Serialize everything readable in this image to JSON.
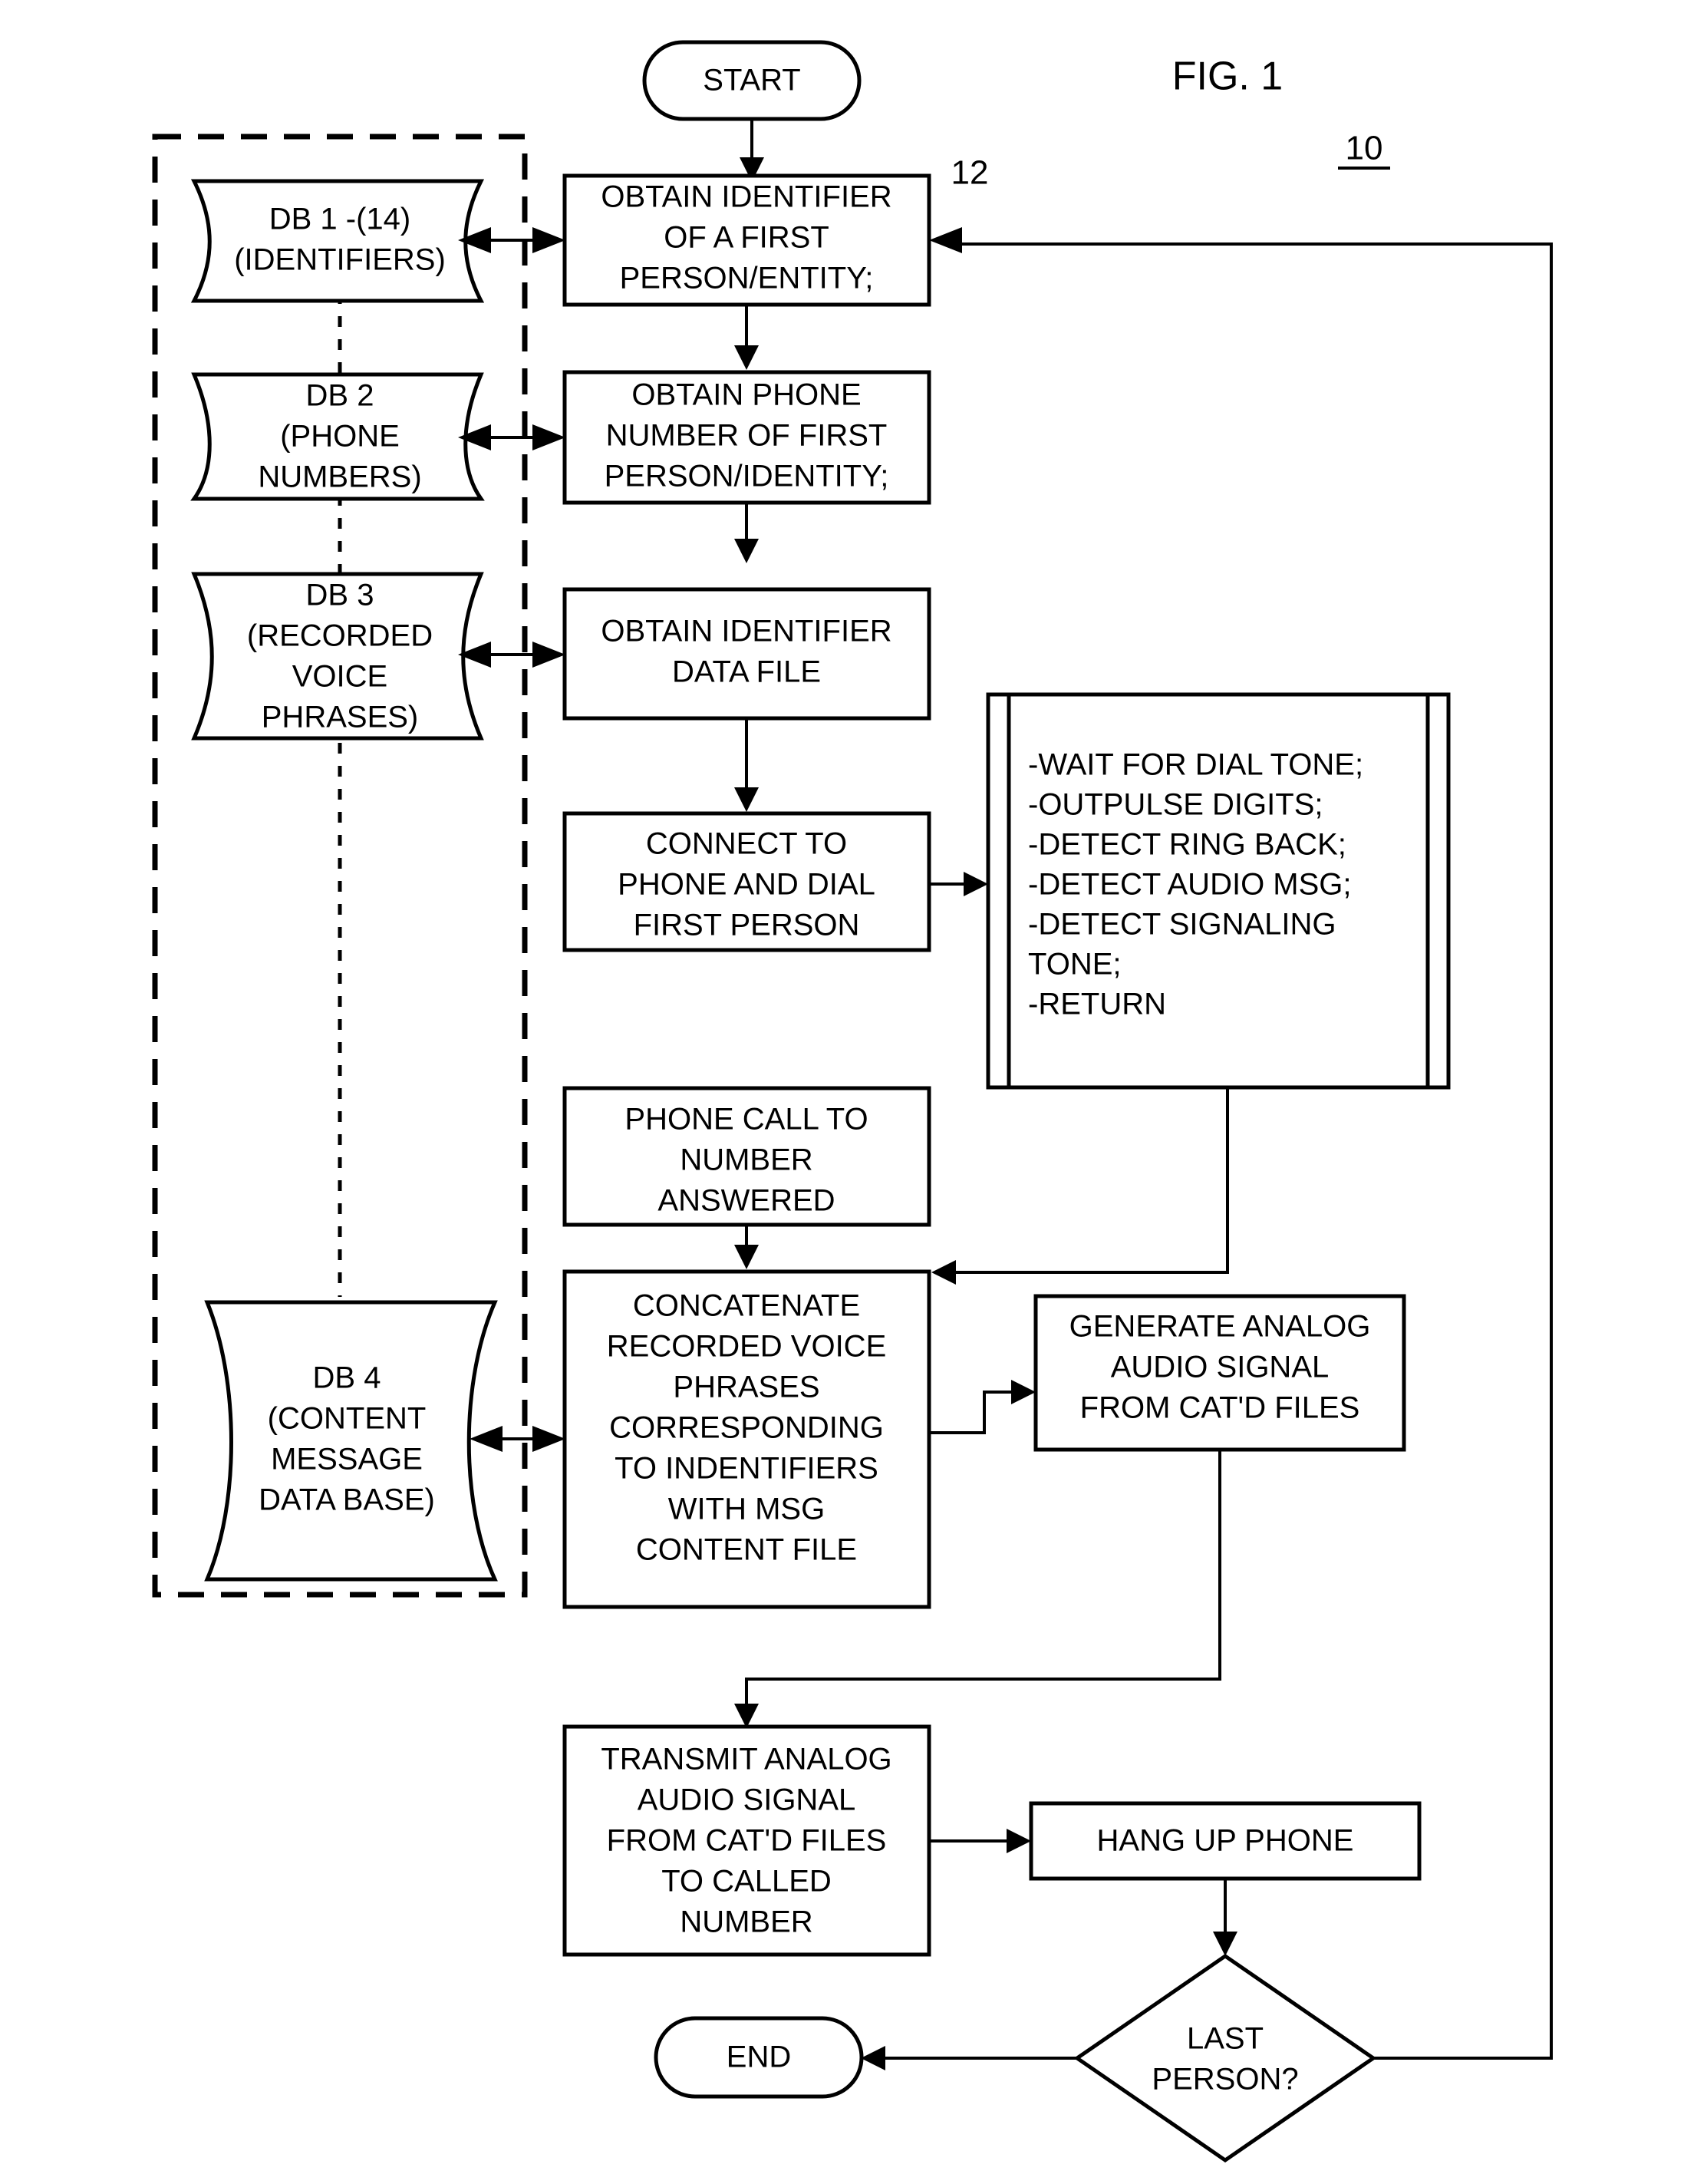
{
  "figure": {
    "title": "FIG. 1",
    "reference_number": "10",
    "callout_12": "12"
  },
  "terminals": {
    "start": "START",
    "end": "END"
  },
  "databases": [
    {
      "id": "db1",
      "lines": [
        "DB 1 -(14)",
        "(IDENTIFIERS)"
      ]
    },
    {
      "id": "db2",
      "lines": [
        "DB 2",
        "(PHONE",
        "NUMBERS)"
      ]
    },
    {
      "id": "db3",
      "lines": [
        "DB 3",
        "(RECORDED",
        "VOICE",
        "PHRASES)"
      ]
    },
    {
      "id": "db4",
      "lines": [
        "DB 4",
        "(CONTENT",
        "MESSAGE",
        "DATA BASE)"
      ]
    }
  ],
  "process_steps": [
    {
      "id": "obtain-identifier-person",
      "lines": [
        "OBTAIN IDENTIFIER",
        "OF A FIRST",
        "PERSON/ENTITY;"
      ]
    },
    {
      "id": "obtain-phone-number",
      "lines": [
        "OBTAIN PHONE",
        "NUMBER OF FIRST",
        "PERSON/IDENTITY;"
      ]
    },
    {
      "id": "obtain-identifier-data-file",
      "lines": [
        "OBTAIN IDENTIFIER",
        "DATA FILE"
      ]
    },
    {
      "id": "connect-and-dial",
      "lines": [
        "CONNECT TO",
        "PHONE AND DIAL",
        "FIRST PERSON"
      ]
    },
    {
      "id": "phone-call-answered",
      "lines": [
        "PHONE CALL TO",
        "NUMBER",
        "ANSWERED"
      ]
    },
    {
      "id": "concatenate-voice-phrases",
      "lines": [
        "CONCATENATE",
        "RECORDED VOICE",
        "PHRASES",
        "CORRESPONDING",
        "TO INDENTIFIERS",
        "WITH MSG",
        "CONTENT FILE"
      ]
    },
    {
      "id": "generate-analog-audio",
      "lines": [
        "GENERATE ANALOG",
        "AUDIO SIGNAL",
        "FROM CAT'D FILES"
      ]
    },
    {
      "id": "transmit-analog-audio",
      "lines": [
        "TRANSMIT ANALOG",
        "AUDIO SIGNAL",
        "FROM CAT'D FILES",
        "TO CALLED",
        "NUMBER"
      ]
    },
    {
      "id": "hang-up-phone",
      "lines": [
        "HANG UP PHONE"
      ]
    }
  ],
  "subroutine": {
    "id": "dial-subroutine",
    "lines": [
      "-WAIT FOR DIAL TONE;",
      "-OUTPULSE DIGITS;",
      "-DETECT RING BACK;",
      "-DETECT AUDIO MSG;",
      "-DETECT SIGNALING",
      "TONE;",
      "-RETURN"
    ]
  },
  "decision": {
    "id": "last-person-decision",
    "lines": [
      "LAST",
      "PERSON?"
    ]
  },
  "colors": {
    "stroke": "#000000",
    "background": "#ffffff"
  }
}
